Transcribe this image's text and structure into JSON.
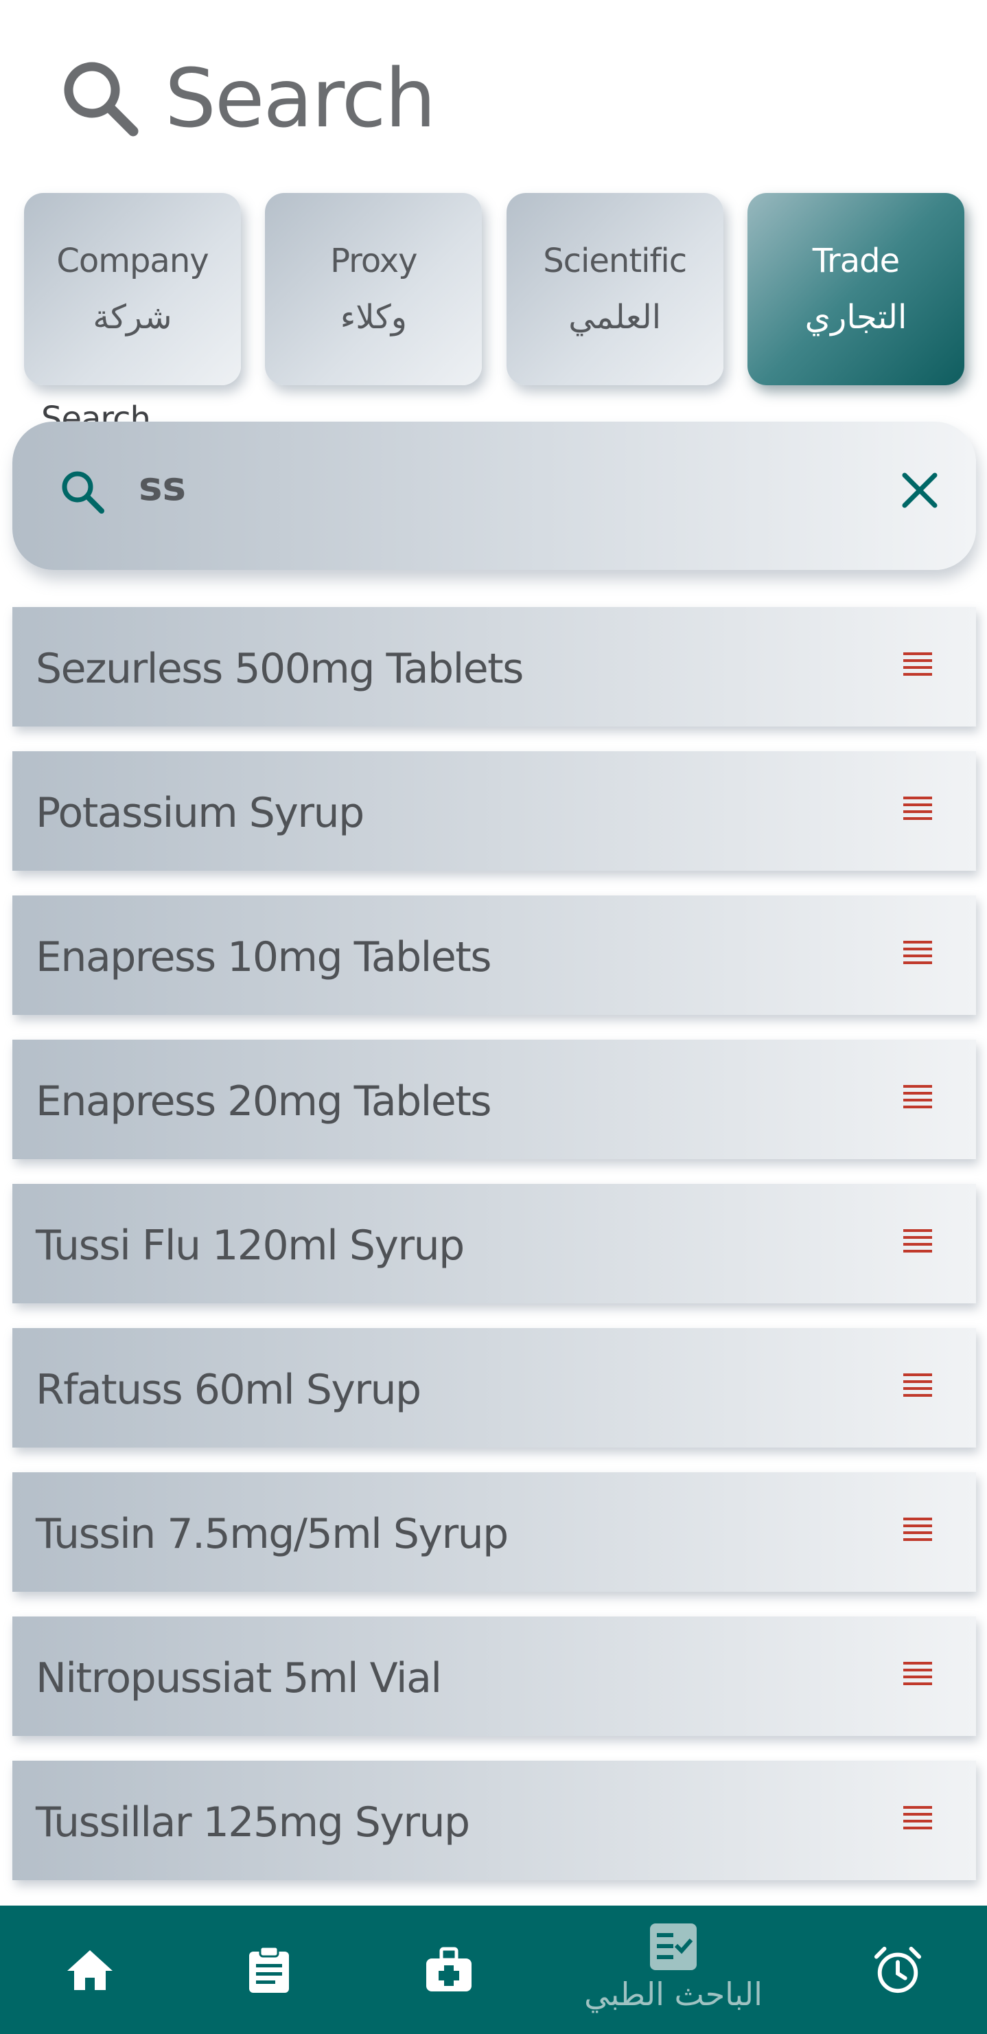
{
  "header": {
    "title": "Search",
    "icon": "search-icon"
  },
  "tabs": [
    {
      "en": "Company",
      "ar": "شركة",
      "active": false
    },
    {
      "en": "Proxy",
      "ar": "وكلاء",
      "active": false
    },
    {
      "en": "Scientific",
      "ar": "العلمي",
      "active": false
    },
    {
      "en": "Trade",
      "ar": "التجاري",
      "active": true
    }
  ],
  "search": {
    "label": "Search",
    "value": "ss"
  },
  "results": [
    "Sezurless 500mg Tablets",
    "Potassium Syrup",
    "Enapress 10mg Tablets",
    "Enapress 20mg Tablets",
    "Tussi Flu 120ml Syrup",
    "Rfatuss 60ml Syrup",
    "Tussin 7.5mg/5ml Syrup",
    "Nitropussiat 5ml Vial",
    "Tussillar 125mg Syrup"
  ],
  "bottom_nav": {
    "active_label": "الباحث الطبي"
  },
  "colors": {
    "accent": "#006766",
    "menu_icon": "#c0392b",
    "text": "#4f5256"
  }
}
